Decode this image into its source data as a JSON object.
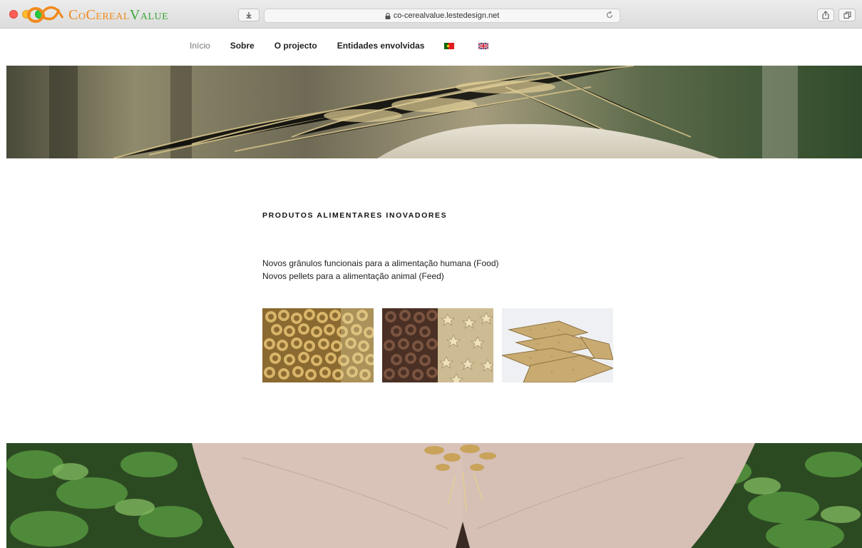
{
  "browser": {
    "url": "co-cerealvalue.lestedesign.net"
  },
  "logo": {
    "co": "Co",
    "cereal": "Cereal",
    "value": "Value"
  },
  "nav": {
    "items": [
      {
        "label": "Início"
      },
      {
        "label": "Sobre"
      },
      {
        "label": "O projecto"
      },
      {
        "label": "Entidades envolvidas"
      }
    ]
  },
  "content": {
    "title": "PRODUTOS ALIMENTARES INOVADORES",
    "lines": [
      "Novos grânulos funcionais para a alimentação humana (Food)",
      "Novos pellets para a alimentação animal (Feed)"
    ]
  },
  "colors": {
    "orange": "#f08a1c",
    "green": "#3aa635"
  },
  "icons": {
    "lock": "lock-icon",
    "reload": "reload-icon",
    "share": "share-icon",
    "tabs": "tabs-icon"
  }
}
